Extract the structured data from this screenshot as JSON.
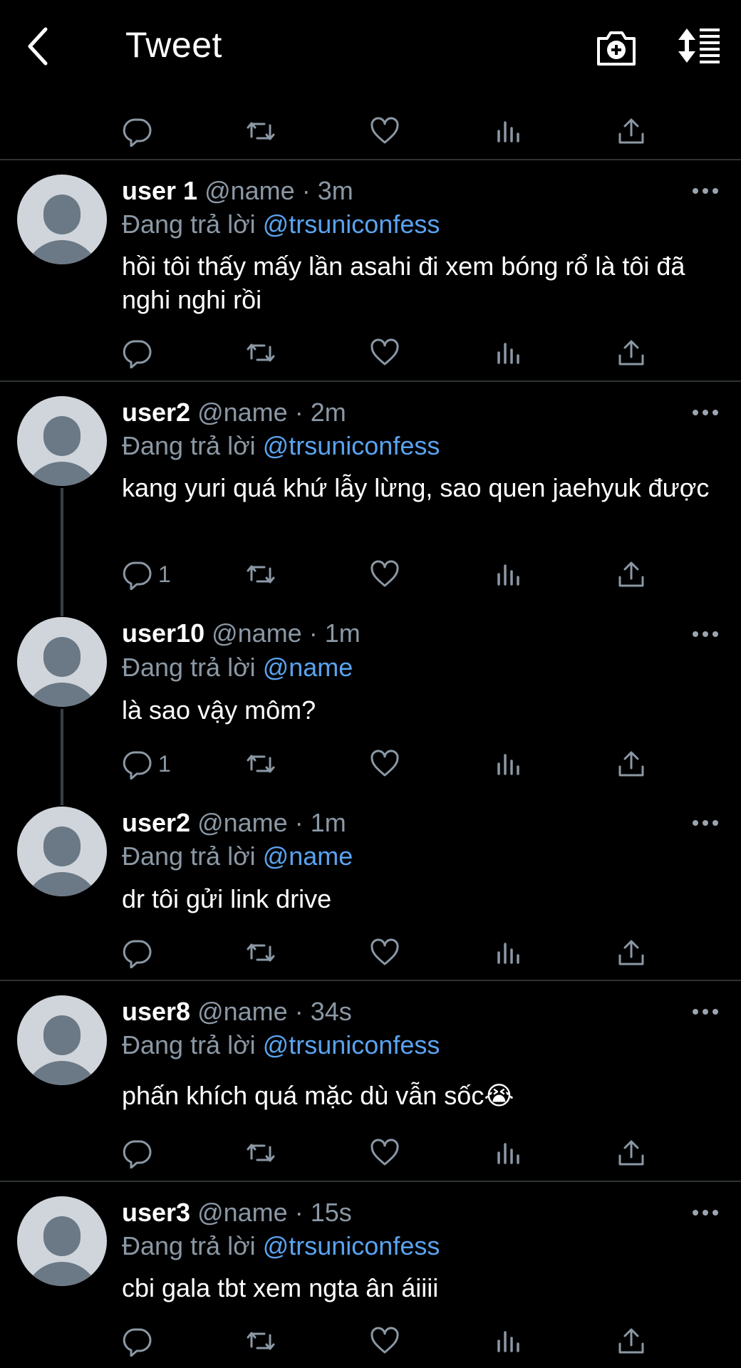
{
  "header": {
    "title": "Tweet",
    "back_icon": "chevron-left-icon",
    "camera_icon": "camera-plus-icon",
    "sort_icon": "sort-lines-icon"
  },
  "tweets": [
    {
      "user": "user 1",
      "handle": "@name",
      "time": "· 3m",
      "reply_prefix": "Đang trả lời",
      "reply_to": "@trsuniconfess",
      "text": "hồi tôi thấy mấy lần asahi đi xem bóng rổ là tôi đã nghi nghi rồi",
      "reply_count": ""
    },
    {
      "user": "user2",
      "handle": "@name",
      "time": "· 2m",
      "reply_prefix": "Đang trả lời",
      "reply_to": "@trsuniconfess",
      "text": "kang yuri quá khứ lẫy lừng, sao quen jaehyuk được",
      "reply_count": "1"
    },
    {
      "user": "user10",
      "handle": "@name",
      "time": "· 1m",
      "reply_prefix": "Đang trả lời",
      "reply_to": "@name",
      "text": "là sao vậy môm?",
      "reply_count": "1"
    },
    {
      "user": "user2",
      "handle": "@name",
      "time": "· 1m",
      "reply_prefix": "Đang trả lời",
      "reply_to": "@name",
      "text": "dr tôi gửi link drive",
      "reply_count": ""
    },
    {
      "user": "user8",
      "handle": "@name",
      "time": "· 34s",
      "reply_prefix": "Đang trả lời",
      "reply_to": "@trsuniconfess",
      "text": "phấn khích quá mặc dù vẫn sốc😭",
      "reply_count": ""
    },
    {
      "user": "user3",
      "handle": "@name",
      "time": "· 15s",
      "reply_prefix": "Đang trả lời",
      "reply_to": "@trsuniconfess",
      "text": "cbi gala tbt xem ngta ân áiiii",
      "reply_count": ""
    }
  ],
  "colors": {
    "background": "#000000",
    "link": "#5aa3f0",
    "muted": "#8b98a5",
    "avatar_bg": "#cfd5db",
    "avatar_fg": "#6b7885"
  }
}
